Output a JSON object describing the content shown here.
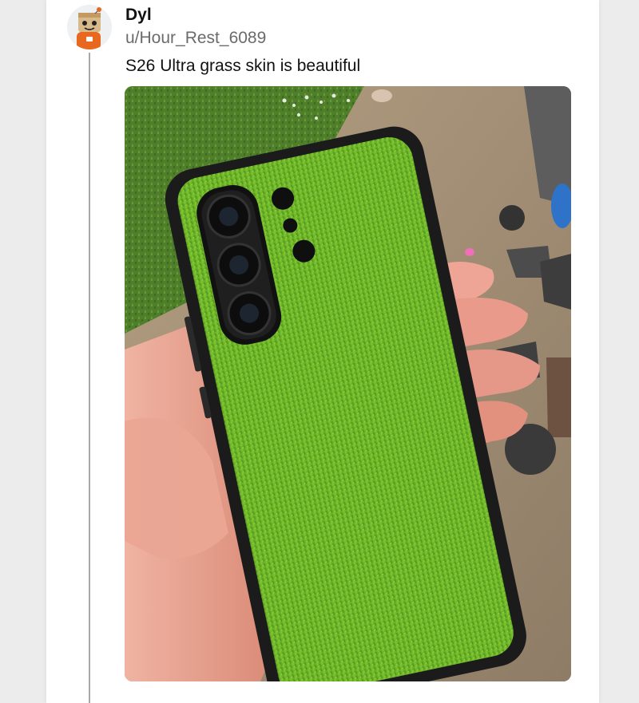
{
  "post": {
    "display_name": "Dyl",
    "username": "u/Hour_Rest_6089",
    "text": "S26 Ultra grass skin is beautiful",
    "avatar_icon": "reddit-snoo-avatar-icon",
    "image_alt": "S26 Ultra grass skin is beautiful"
  },
  "colors": {
    "grass": "#6fb52a",
    "case": "#1b1b1b",
    "skin": "#e8a592",
    "concrete": "#a38f74",
    "lawn": "#4f7d2a"
  }
}
